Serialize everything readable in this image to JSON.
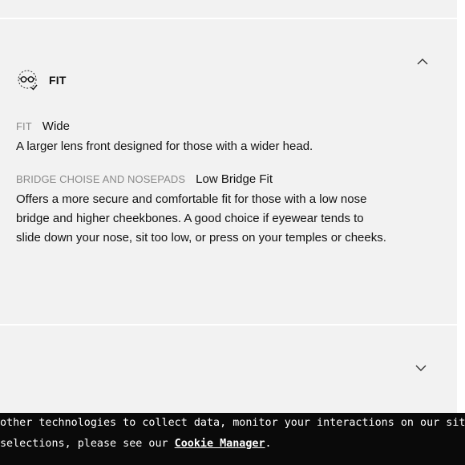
{
  "fit_section": {
    "title": "FIT",
    "icon": "glasses-face-icon",
    "attributes": [
      {
        "label": "FIT",
        "value": "Wide",
        "description": "A larger lens front designed for those with a wider head."
      },
      {
        "label": "BRIDGE CHOISE AND NOSEPADS",
        "value": "Low Bridge Fit",
        "description_lines": [
          "Offers a more secure and comfortable fit for those with a low nose",
          "bridge and higher cheekbones. A good choice if eyewear tends to",
          "slide down your nose, sit too low, or press on your temples or cheeks."
        ]
      }
    ]
  },
  "cookie_banner": {
    "line1": "other technologies to collect data, monitor your interactions on our site, and/or adverti",
    "line2_prefix": "selections, please see our ",
    "link_label": "Cookie Manager",
    "line2_suffix": "."
  },
  "colors": {
    "panel_bg": "#f2f2f2",
    "divider": "#ffffff",
    "label_gray": "#8a8a8a",
    "text": "#111111",
    "banner_bg": "#0a0a0a"
  }
}
